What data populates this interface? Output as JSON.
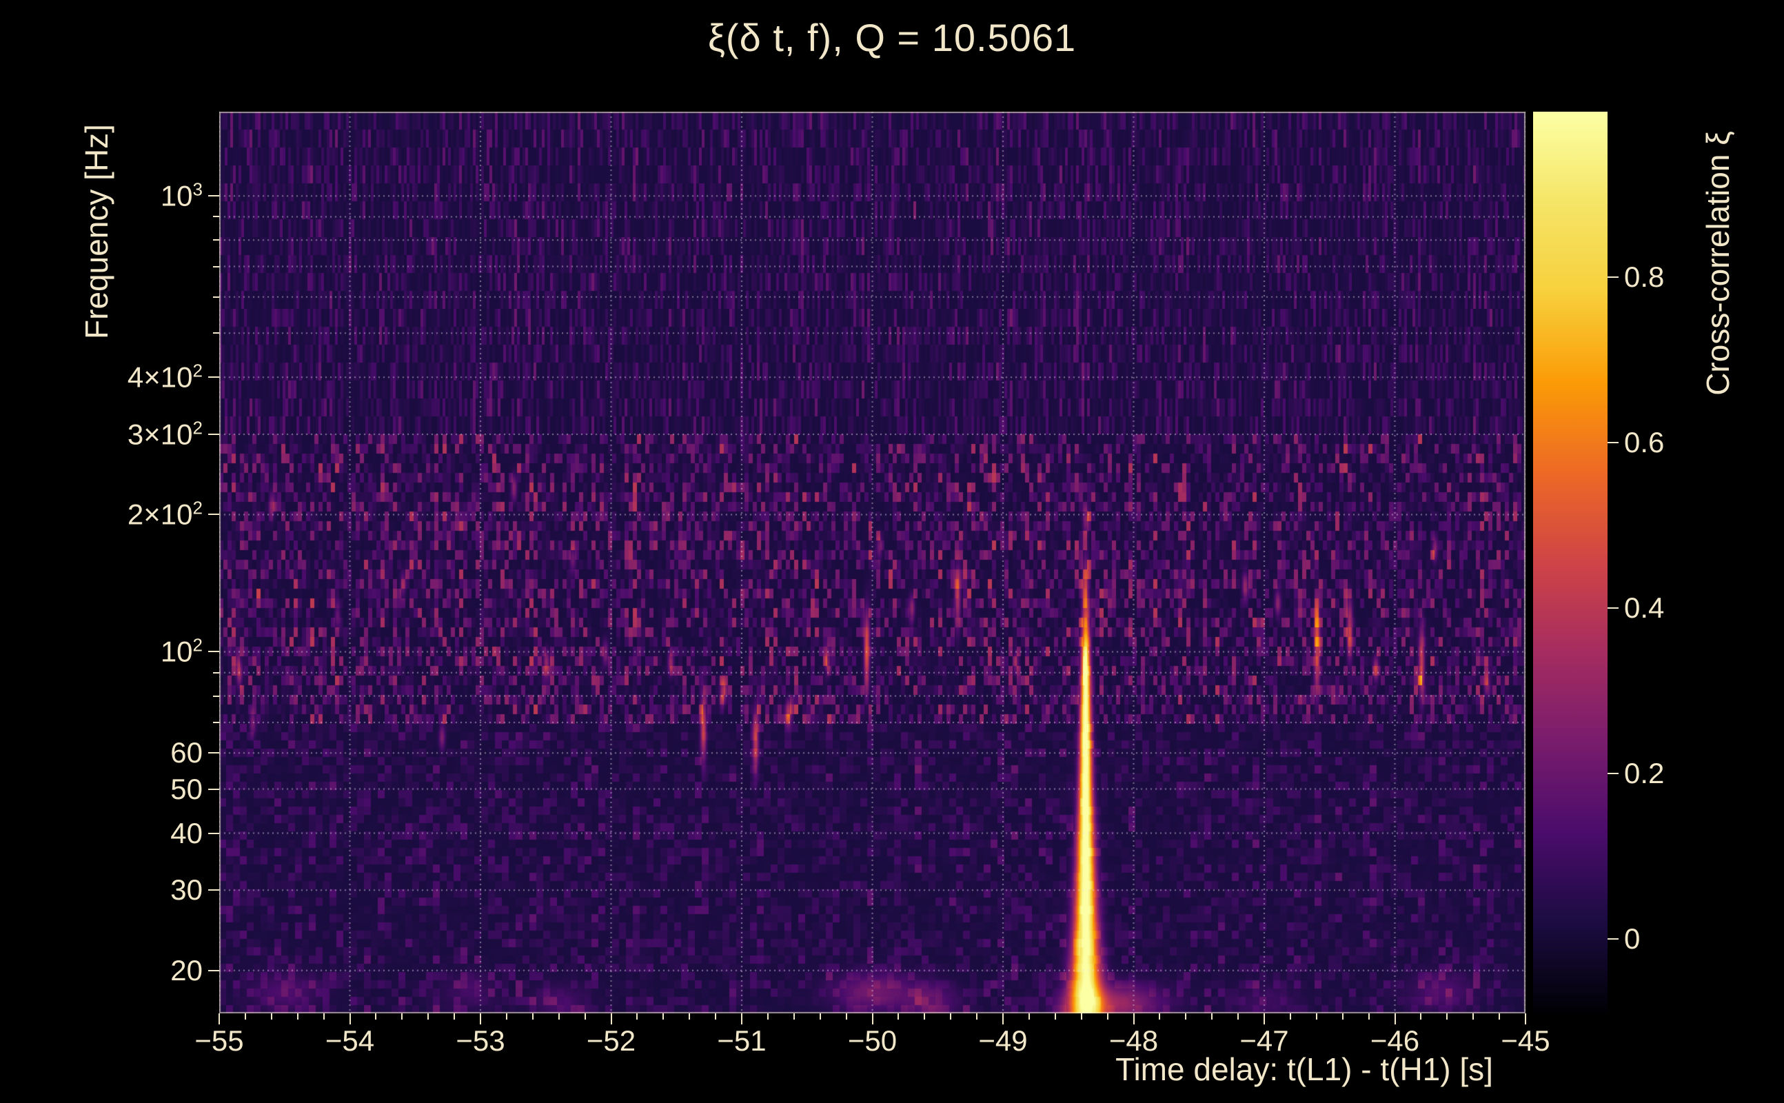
{
  "figure": {
    "background": "#000000",
    "text_color": "#f2e7c9"
  },
  "chart_data": {
    "type": "heatmap",
    "title": "ξ(δ t, f), Q = 10.5061",
    "q_value": 10.5061,
    "xlabel": "Time delay: t(L1) - t(H1) [s]",
    "ylabel": "Frequency [Hz]",
    "colorbar_label": "Cross-correlation ξ",
    "x_range_s": [
      -55,
      -45
    ],
    "y_range_hz": [
      16.1,
      1530
    ],
    "y_scale": "log",
    "grid": true,
    "color_range": [
      -0.09,
      1.0
    ],
    "x_ticks": [
      -55,
      -54,
      -53,
      -52,
      -51,
      -50,
      -49,
      -48,
      -47,
      -46,
      -45
    ],
    "x_tick_labels": [
      "−55",
      "−54",
      "−53",
      "−52",
      "−51",
      "−50",
      "−49",
      "−48",
      "−47",
      "−46",
      "−45"
    ],
    "y_ticks": [
      {
        "f": 1000,
        "base": "10",
        "sup": "3"
      },
      {
        "f": 400,
        "base": "4×10",
        "sup": "2"
      },
      {
        "f": 300,
        "base": "3×10",
        "sup": "2"
      },
      {
        "f": 200,
        "base": "2×10",
        "sup": "2"
      },
      {
        "f": 100,
        "base": "10",
        "sup": "2"
      },
      {
        "f": 60,
        "base": "60"
      },
      {
        "f": 50,
        "base": "50"
      },
      {
        "f": 40,
        "base": "40"
      },
      {
        "f": 30,
        "base": "30"
      },
      {
        "f": 20,
        "base": "20"
      }
    ],
    "y_minor_ticks": [
      70,
      80,
      90,
      500,
      600,
      700,
      800,
      900
    ],
    "grid_freqs": [
      20,
      30,
      40,
      50,
      60,
      70,
      80,
      90,
      100,
      200,
      300,
      400,
      500,
      600,
      700,
      800,
      900,
      1000
    ],
    "colorbar_ticks": [
      {
        "v": 0.8,
        "label": "0.8"
      },
      {
        "v": 0.6,
        "label": "0.6"
      },
      {
        "v": 0.4,
        "label": "0.4"
      },
      {
        "v": 0.2,
        "label": "0.2"
      },
      {
        "v": 0.0,
        "label": "0"
      }
    ],
    "colormap": {
      "name": "inferno",
      "stops": [
        {
          "u": 0.0,
          "hex": "#000004"
        },
        {
          "u": 0.1,
          "hex": "#1b0c41"
        },
        {
          "u": 0.2,
          "hex": "#4a0c6b"
        },
        {
          "u": 0.3,
          "hex": "#781c6d"
        },
        {
          "u": 0.4,
          "hex": "#a52c60"
        },
        {
          "u": 0.5,
          "hex": "#cf4446"
        },
        {
          "u": 0.6,
          "hex": "#ed6925"
        },
        {
          "u": 0.7,
          "hex": "#fb9b06"
        },
        {
          "u": 0.8,
          "hex": "#f7d03c"
        },
        {
          "u": 0.9,
          "hex": "#f5e567"
        },
        {
          "u": 1.0,
          "hex": "#fcffa4"
        }
      ]
    },
    "noise": {
      "background_level": 0.016,
      "bands": [
        {
          "f_above": 300,
          "amp": 0.085
        },
        {
          "f_above": 70,
          "amp": 0.16
        },
        {
          "f_above": 0,
          "amp": 0.07
        }
      ]
    },
    "main_feature": {
      "description": "bright vertical cross-correlation plume (chirp) peaking near white",
      "t0": -48.37,
      "sigma_s_base": 0.01,
      "sigma_s_scale": 1.3,
      "profile": [
        [
          16,
          0.85
        ],
        [
          20,
          0.98
        ],
        [
          30,
          1.06
        ],
        [
          80,
          1.06
        ],
        [
          100,
          0.9
        ],
        [
          112,
          0.6
        ],
        [
          125,
          0.4
        ],
        [
          140,
          0.28
        ],
        [
          155,
          0.18
        ],
        [
          170,
          0.08
        ],
        [
          195,
          0.0
        ]
      ]
    },
    "blobs": [
      [
        -54.85,
        90,
        0.3
      ],
      [
        -54.75,
        70,
        0.22
      ],
      [
        -54.6,
        210,
        0.2
      ],
      [
        -54.1,
        120,
        0.18
      ],
      [
        -53.6,
        140,
        0.18
      ],
      [
        -53.3,
        65,
        0.22
      ],
      [
        -52.75,
        230,
        0.25
      ],
      [
        -52.5,
        95,
        0.28
      ],
      [
        -52.3,
        160,
        0.2
      ],
      [
        -52.05,
        100,
        0.22
      ],
      [
        -51.55,
        95,
        0.3
      ],
      [
        -51.3,
        68,
        0.42,
        0.05
      ],
      [
        -51.15,
        82,
        0.32
      ],
      [
        -50.9,
        64,
        0.38,
        0.05
      ],
      [
        -50.65,
        74,
        0.34
      ],
      [
        -50.35,
        95,
        0.26
      ],
      [
        -50.05,
        102,
        0.42,
        0.06
      ],
      [
        -49.95,
        170,
        0.2
      ],
      [
        -49.7,
        125,
        0.28
      ],
      [
        -49.35,
        132,
        0.34,
        0.05
      ],
      [
        -48.9,
        95,
        0.2
      ],
      [
        -48.37,
        195,
        0.22
      ],
      [
        -47.15,
        140,
        0.3
      ],
      [
        -46.9,
        128,
        0.26
      ],
      [
        -46.6,
        100,
        0.4,
        0.07
      ],
      [
        -46.35,
        112,
        0.36,
        0.05
      ],
      [
        -46.15,
        92,
        0.3
      ],
      [
        -45.8,
        95,
        0.4,
        0.06
      ],
      [
        -45.7,
        168,
        0.24
      ],
      [
        -45.3,
        85,
        0.22
      ]
    ],
    "low_band_blobs": [
      [
        -54.5,
        18,
        0.12,
        0.18
      ],
      [
        -53.1,
        18,
        0.08,
        0.15
      ],
      [
        -52.4,
        17,
        0.1,
        0.15
      ],
      [
        -50.0,
        18,
        0.2,
        0.22
      ],
      [
        -49.55,
        17,
        0.15,
        0.15
      ],
      [
        -48.15,
        17,
        0.3,
        0.25
      ],
      [
        -47.0,
        17,
        0.08,
        0.18
      ],
      [
        -45.65,
        18,
        0.12,
        0.18
      ]
    ]
  }
}
